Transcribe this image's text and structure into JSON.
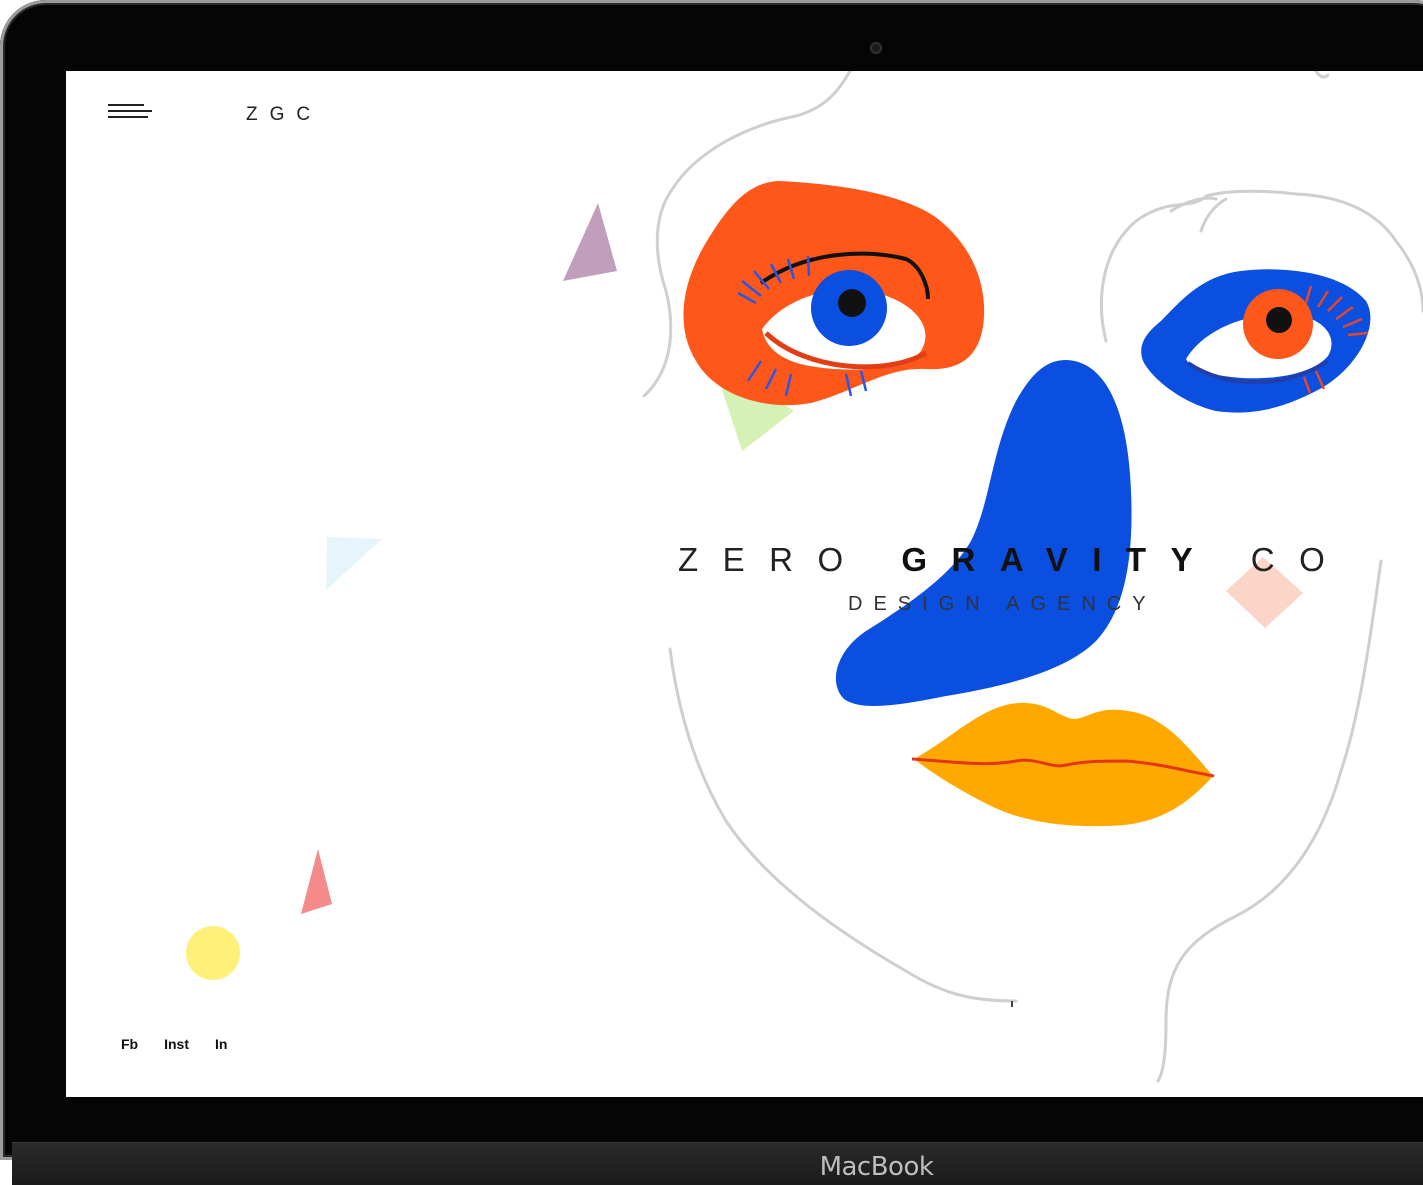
{
  "header": {
    "menu_icon": "hamburger-menu-icon",
    "brand": "ZGC"
  },
  "hero": {
    "title_part1": "ZERO",
    "title_part2": "GRAVITY",
    "title_part3": "CO",
    "subtitle": "DESIGN AGENCY"
  },
  "social": {
    "links": [
      "Fb",
      "Inst",
      "In"
    ]
  },
  "device": {
    "label": "MacBook"
  },
  "colors": {
    "orange": "#ff5619",
    "blue": "#0a4fe0",
    "lips": "#ffa900",
    "outline": "#cfcfcf"
  }
}
